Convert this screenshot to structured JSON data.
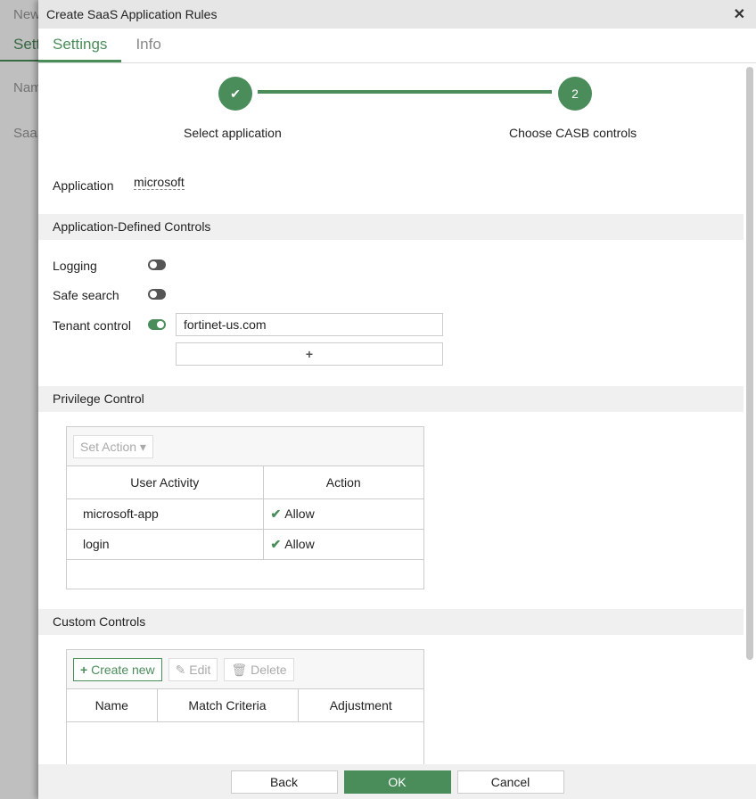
{
  "background": {
    "items": [
      "New",
      "Setti",
      "Nam",
      "SaaS"
    ]
  },
  "dialog": {
    "title": "Create SaaS Application Rules",
    "tabs": [
      {
        "label": "Settings"
      },
      {
        "label": "Info"
      }
    ]
  },
  "steps": [
    {
      "label": "Select application",
      "state": "done"
    },
    {
      "label": "Choose CASB controls",
      "number": "2"
    }
  ],
  "application": {
    "label": "Application",
    "value": "microsoft"
  },
  "app_controls": {
    "title": "Application-Defined Controls",
    "logging": {
      "label": "Logging",
      "on": false
    },
    "safe_search": {
      "label": "Safe search",
      "on": false
    },
    "tenant": {
      "label": "Tenant control",
      "on": true,
      "value": "fortinet-us.com",
      "add": "+"
    }
  },
  "privilege": {
    "title": "Privilege Control",
    "set_action": "Set Action ▾",
    "columns": [
      "User Activity",
      "Action"
    ],
    "rows": [
      {
        "activity": "microsoft-app",
        "action": "Allow"
      },
      {
        "activity": "login",
        "action": "Allow"
      }
    ]
  },
  "custom": {
    "title": "Custom Controls",
    "create": "Create new",
    "edit": "Edit",
    "delete": "Delete",
    "columns": [
      "Name",
      "Match Criteria",
      "Adjustment"
    ]
  },
  "footer": {
    "back": "Back",
    "ok": "OK",
    "cancel": "Cancel"
  }
}
